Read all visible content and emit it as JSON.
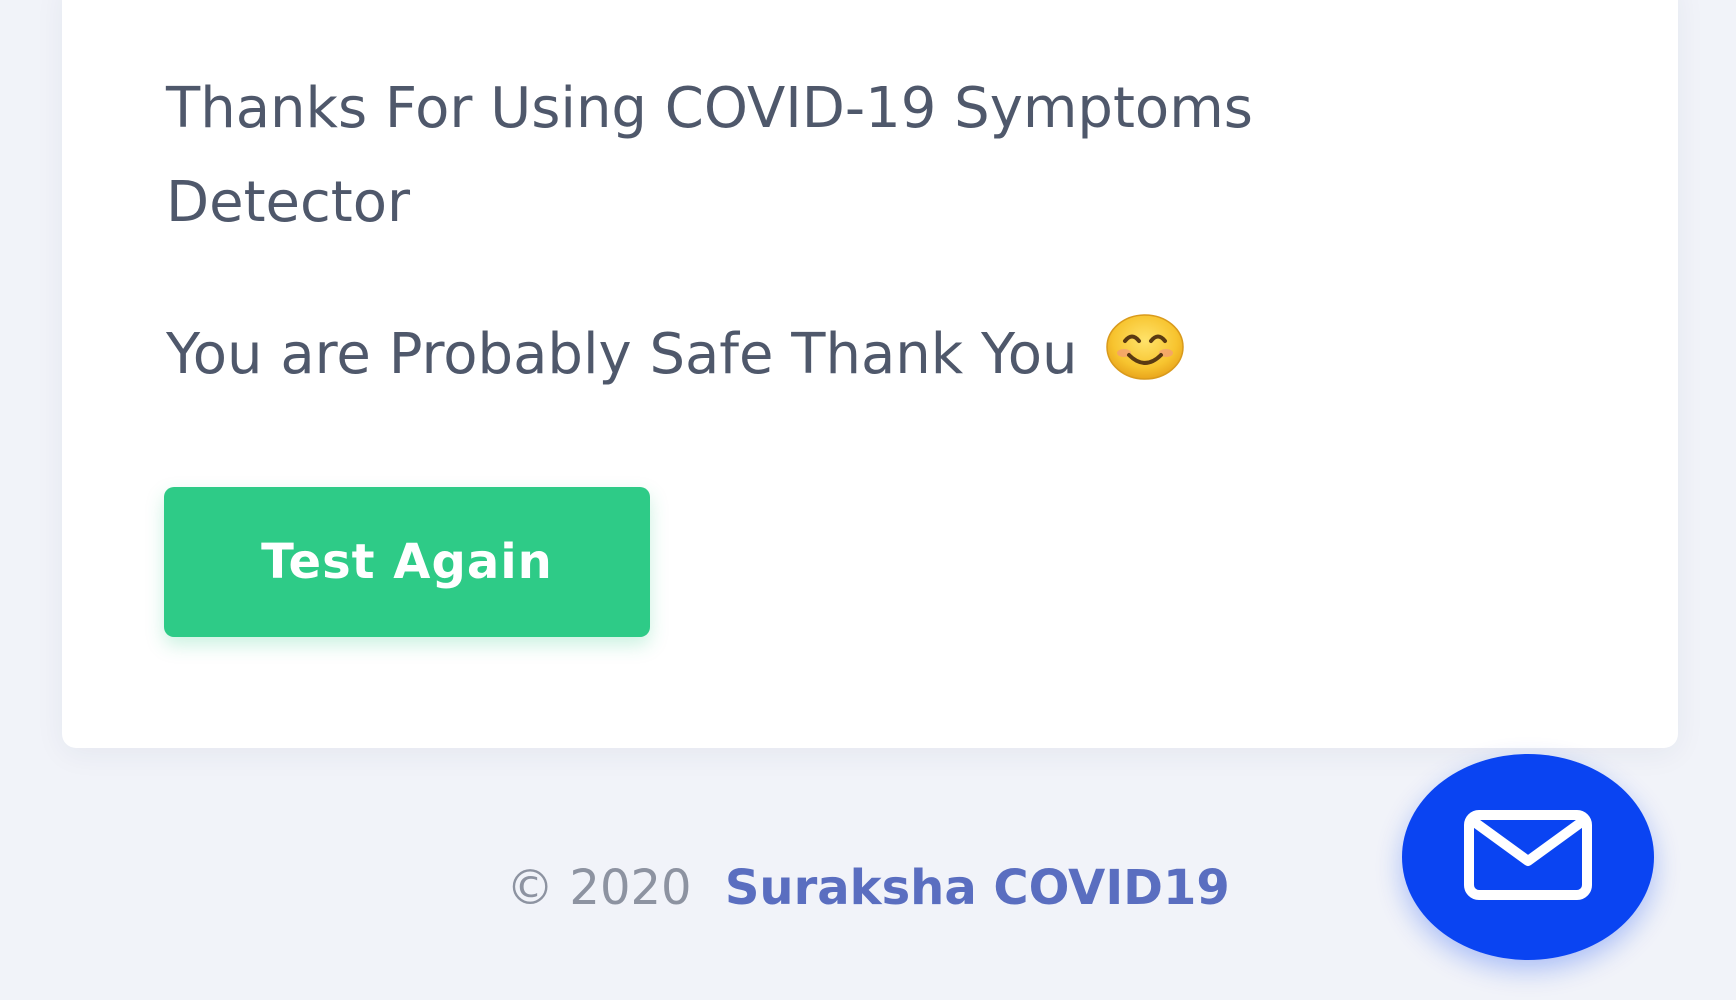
{
  "result_card": {
    "thanks_message": "Thanks For Using COVID-19 Symptoms Detector",
    "result_message": "You are Probably Safe Thank You",
    "emoji": "smiling-face-icon",
    "button_label": "Test Again"
  },
  "footer": {
    "copyright": "© 2020",
    "brand_link": "Suraksha COVID19"
  },
  "floating_button": {
    "icon": "mail-icon"
  },
  "colors": {
    "page_background": "#f1f3f9",
    "card_background": "#ffffff",
    "text": "#4f586b",
    "button_green": "#2ecb87",
    "brand_link": "#5a6ec0",
    "fab_blue": "#0a44f2"
  }
}
